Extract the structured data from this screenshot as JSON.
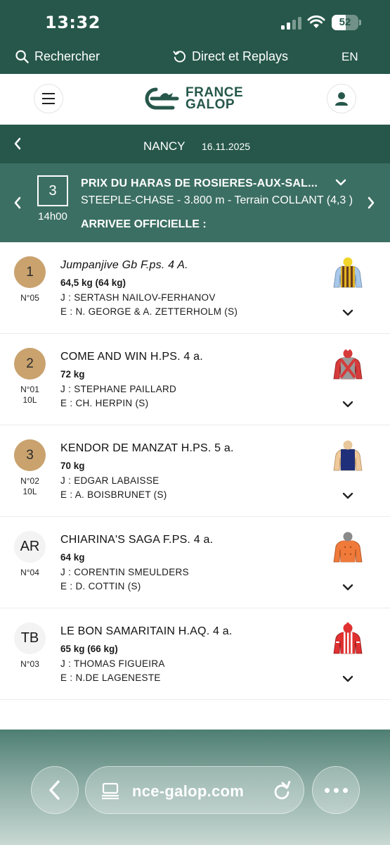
{
  "status_bar": {
    "time": "13:32",
    "battery": "52",
    "battery_level": 0.52
  },
  "top_nav": {
    "search_label": "Rechercher",
    "direct_label": "Direct et Replays",
    "language": "EN"
  },
  "header": {
    "logo_line1": "FRANCE",
    "logo_line2": "GALOP"
  },
  "race_bar": {
    "venue": "NANCY",
    "date": "16.11.2025"
  },
  "race": {
    "number": "3",
    "time": "14h00",
    "title": "PRIX DU HARAS DE ROSIERES-AUX-SAL...",
    "type": "STEEPLE-CHASE - 3.800 m - Terrain COLLANT (4,3 )",
    "result_label": "ARRIVEE OFFICIELLE :"
  },
  "runners": [
    {
      "position": "1",
      "number": "N°05",
      "distance": "",
      "name": "Jumpanjive Gb F.ps. 4 A.",
      "weight": "64,5 kg (64 kg)",
      "jockey": "J : SERTASH NAILOV-FERHANOV",
      "trainer": "E : N. GEORGE & A. ZETTERHOLM (S)",
      "silks_icon": "silks-yellow-brown-stripes-icon"
    },
    {
      "position": "2",
      "number": "N°01",
      "distance": "10L",
      "name": "COME AND WIN H.PS. 4 a.",
      "weight": "72 kg",
      "jockey": "J : STEPHANE PAILLARD",
      "trainer": "E : CH. HERPIN (S)",
      "silks_icon": "silks-grey-red-cross-icon"
    },
    {
      "position": "3",
      "number": "N°02",
      "distance": "10L",
      "name": "KENDOR DE MANZAT H.PS. 5 a.",
      "weight": "70 kg",
      "jockey": "J : EDGAR LABAISSE",
      "trainer": "E : A. BOISBRUNET (S)",
      "silks_icon": "silks-navy-icon"
    },
    {
      "position": "AR",
      "number": "N°04",
      "distance": "",
      "name": "CHIARINA'S SAGA F.PS. 4 a.",
      "weight": "64 kg",
      "jockey": "J : CORENTIN SMEULDERS",
      "trainer": "E : D. COTTIN (S)",
      "silks_icon": "silks-orange-icon"
    },
    {
      "position": "TB",
      "number": "N°03",
      "distance": "",
      "name": "LE BON SAMARITAIN H.AQ. 4 a.",
      "weight": "65 kg (66 kg)",
      "jockey": "J : THOMAS FIGUEIRA",
      "trainer": "E : N.DE LAGENESTE",
      "silks_icon": "silks-red-white-stripes-icon"
    }
  ],
  "browser": {
    "url": "nce-galop.com"
  },
  "colors": {
    "brand_green": "#26574a",
    "race_card_green": "#3c6f63",
    "gold_badge": "#c9a26e"
  }
}
